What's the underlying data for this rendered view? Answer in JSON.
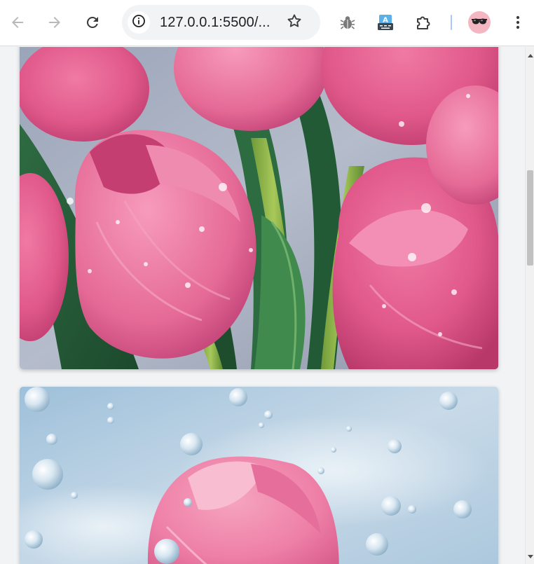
{
  "browser": {
    "url_display": "127.0.0.1:5500/...",
    "buttons": {
      "back": "back-arrow-icon",
      "forward": "forward-arrow-icon",
      "reload": "reload-icon",
      "site_info": "info-icon",
      "bookmark": "star-icon",
      "extension_bug": "bug-icon",
      "extension_translate": "translate-icon",
      "extensions": "puzzle-icon",
      "profile": "avatar",
      "menu": "kebab-menu-icon"
    },
    "colors": {
      "toolbar_bg": "#ffffff",
      "omnibox_bg": "#f1f3f4",
      "page_bg": "#f1f3f5",
      "separator": "#a8c7fa"
    }
  },
  "page": {
    "images": [
      {
        "subject": "pink tulips with water droplets"
      },
      {
        "subject": "pink tulip against blue sky with water droplets"
      }
    ]
  }
}
